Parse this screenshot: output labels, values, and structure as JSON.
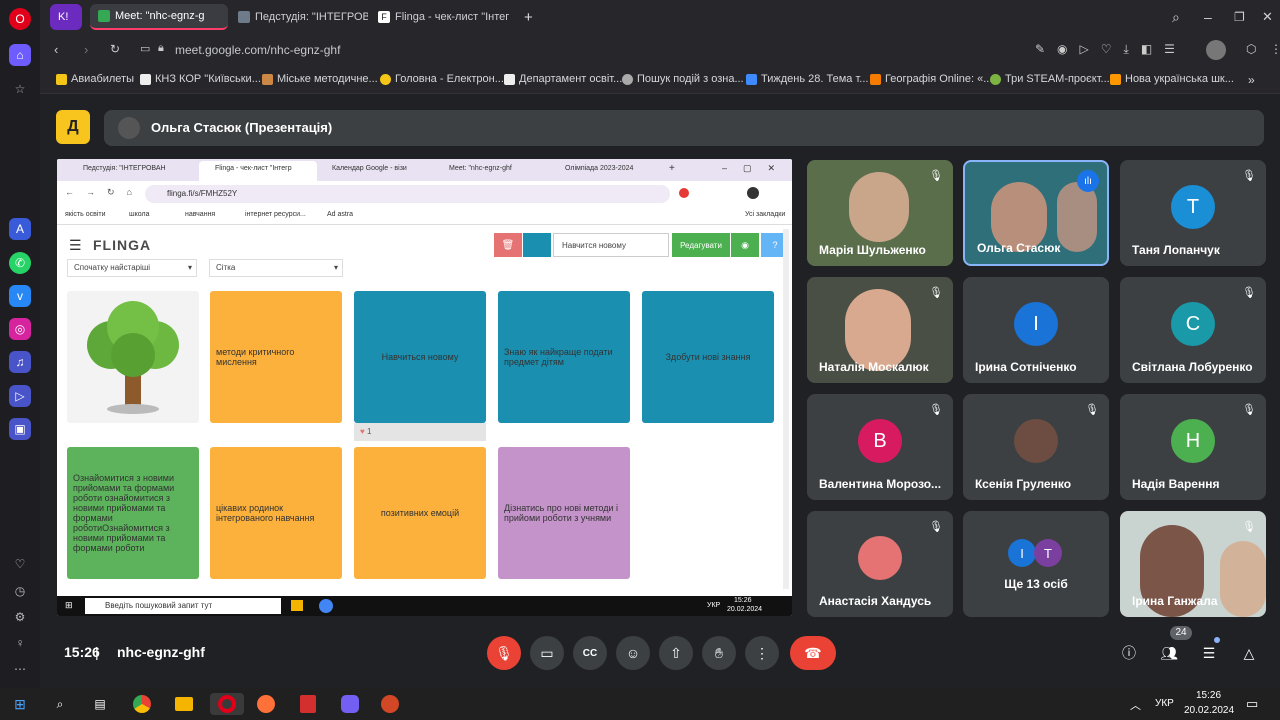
{
  "browser": {
    "tabs": [
      {
        "label": "Meet: \"nhc-egnz-g"
      },
      {
        "label": "Педстудія: \"ІНТЕГРОВАН"
      },
      {
        "label": "Flinga - чек-лист \"Інтегро"
      }
    ],
    "url": "meet.google.com/nhc-egnz-ghf",
    "bookmarks": [
      "Авиабилеты",
      "КНЗ КОР \"Київськи...",
      "Міське методичне...",
      "Головна - Електрон...",
      "Департамент освіт...",
      "Пошук подій з озна...",
      "Тиждень 28. Тема т...",
      "Географія Online: «...",
      "Три STEAM-проєкт...",
      "Нова українська шк..."
    ]
  },
  "meet": {
    "presenter": "Ольга Стасюк (Презентація)",
    "time": "15:26",
    "code": "nhc-egnz-ghf",
    "people_count": "24",
    "participants": [
      {
        "name": "Марія Шульженко",
        "type": "video"
      },
      {
        "name": "Ольга Стасюк",
        "type": "video",
        "active": true
      },
      {
        "name": "Таня Лопанчук",
        "initial": "T",
        "color": "#1a8fd6"
      },
      {
        "name": "Наталія Москалюк",
        "type": "video"
      },
      {
        "name": "Ірина Сотніченко",
        "initial": "I",
        "color": "#1a73d6"
      },
      {
        "name": "Світлана Лобуренко",
        "initial": "С",
        "color": "#1a9aa8"
      },
      {
        "name": "Валентина Морозо...",
        "initial": "В",
        "color": "#d81b60"
      },
      {
        "name": "Ксенія Груленко",
        "type": "photo"
      },
      {
        "name": "Надія Варення",
        "initial": "Н",
        "color": "#4caf50"
      },
      {
        "name": "Анастасія Хандусь",
        "type": "photo"
      },
      {
        "name": "Ще 13 осіб",
        "type": "more"
      },
      {
        "name": "Ірина Ганжала",
        "type": "video"
      }
    ],
    "more_initials": [
      "I",
      "T"
    ]
  },
  "shared": {
    "tabs": [
      "Педстудія: \"ІНТЕГРОВАН",
      "Flinga - чек-лист \"Інтегр",
      "Календар Google - візи",
      "Meet: \"nhc-egnz-ghf",
      "Олімпіада 2023-2024"
    ],
    "url": "flinga.fi/s/FMHZ52Y",
    "bookmarks": [
      "якість освіти",
      "школа",
      "навчання",
      "інтернет ресурси...",
      "Ad astra",
      "Усі закладки"
    ],
    "logo": "FLINGA",
    "search_placeholder": "Навчится новому",
    "edit_label": "Редагувати",
    "sort_select": "Спочатку найстаріші",
    "view_select": "Сітка",
    "cards": [
      {
        "text": "методи критичного мислення",
        "color": "#fbb13c"
      },
      {
        "text": "Навчиться новому",
        "color": "#1a8fb0",
        "likes": "1"
      },
      {
        "text": "Знаю як найкраще подати предмет дітям",
        "color": "#1a8fb0"
      },
      {
        "text": "Здобути нові знання",
        "color": "#1a8fb0"
      },
      {
        "text": "Ознайомитися з новими прийомами та формами роботи ознайомитися з новими прийомами та формами роботиОзнайомитися з новими прийомами та формами роботи",
        "color": "#5cb35c"
      },
      {
        "text": "цікавих родинок інтегрованого навчання",
        "color": "#fbb13c"
      },
      {
        "text": "позитивних емоцій",
        "color": "#fbb13c"
      },
      {
        "text": "Дізнатись про нові методи і прийоми роботи з учнями",
        "color": "#c393c9"
      }
    ],
    "taskbar_search": "Введіть пошуковий запит тут",
    "lang": "УКР",
    "time": "15:26",
    "date": "20.02.2024"
  },
  "taskbar": {
    "lang": "УКР",
    "time": "15:26",
    "date": "20.02.2024"
  }
}
